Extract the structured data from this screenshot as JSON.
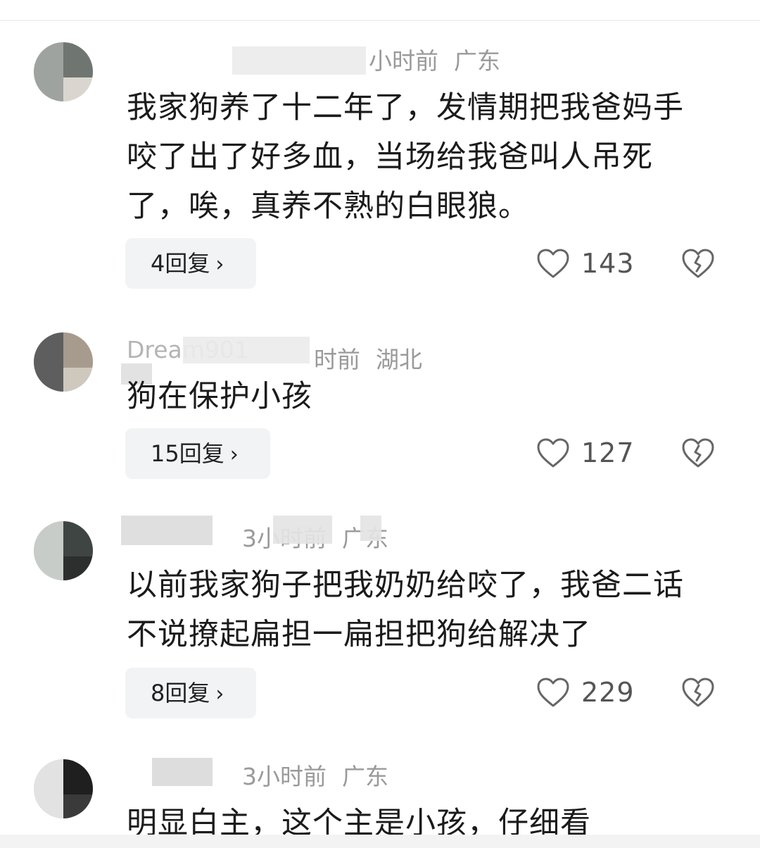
{
  "comments": [
    {
      "username": "",
      "time": "小时前",
      "location": "广东",
      "text": "我家狗养了十二年了，发情期把我爸妈手咬了出了好多血，当场给我爸叫人吊死了，唉，真养不熟的白眼狼。",
      "replies": "4回复",
      "likes": "143"
    },
    {
      "username": "Dream901",
      "time": "时前",
      "location": "湖北",
      "text": "狗在保护小孩",
      "replies": "15回复",
      "likes": "127"
    },
    {
      "username": "",
      "time": "3小时前",
      "location": "广东",
      "text": "以前我家狗子把我奶奶给咬了，我爸二话不说撩起扁担一扁担把狗给解决了",
      "replies": "8回复",
      "likes": "229"
    },
    {
      "username": "",
      "time": "3小时前",
      "location": "广东",
      "text": "明显白主，这个主是小孩，仔细看",
      "replies": "",
      "likes": ""
    }
  ],
  "icons": {
    "like": "heart-outline-icon",
    "dislike": "broken-heart-icon",
    "chevron": "chevron-right-icon"
  },
  "chevron_glyph": "›"
}
